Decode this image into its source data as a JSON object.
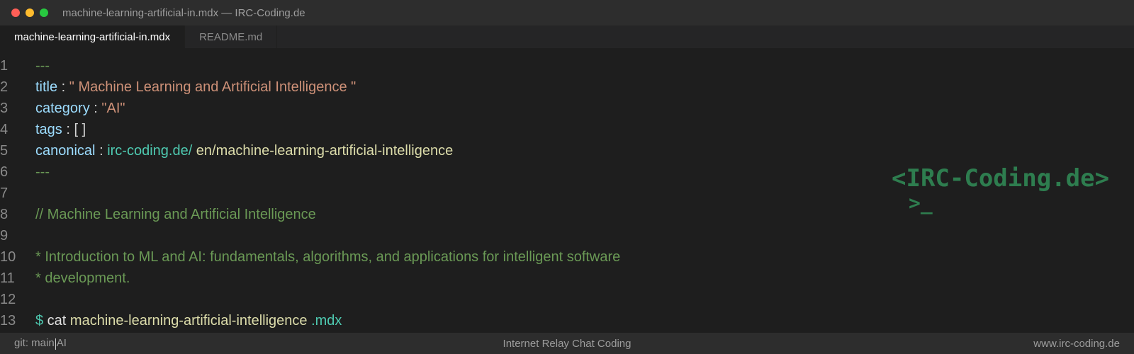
{
  "window": {
    "title": "machine-learning-artificial-in.mdx — IRC-Coding.de"
  },
  "tabs": [
    {
      "label": "machine-learning-artificial-in.mdx",
      "active": true
    },
    {
      "label": "README.md",
      "active": false
    }
  ],
  "editor": {
    "lines": [
      {
        "num": "1",
        "dash": "---"
      },
      {
        "num": "2",
        "key": "title",
        "colon": " : ",
        "value": "\" Machine Learning and Artificial Intelligence \""
      },
      {
        "num": "3",
        "key": "category",
        "colon": " : ",
        "value": "\"AI\""
      },
      {
        "num": "4",
        "key": "tags",
        "colon": " : ",
        "value": "[ ]"
      },
      {
        "num": "5",
        "key": "canonical",
        "colon": " : ",
        "link": "irc-coding.de/",
        "path": " en/machine-learning-artificial-intelligence"
      },
      {
        "num": "6",
        "dash": "---"
      },
      {
        "num": "7"
      },
      {
        "num": "8",
        "comment": "// Machine Learning and Artificial Intelligence"
      },
      {
        "num": "9"
      },
      {
        "num": "10",
        "comment": "* Introduction to ML and AI: fundamentals, algorithms, and applications for intelligent software"
      },
      {
        "num": "11",
        "comment": "* development."
      },
      {
        "num": "12"
      },
      {
        "num": "13",
        "prompt": "$",
        "cmd": " cat ",
        "file": "machine-learning-artificial-intelligence",
        "ext": " .mdx"
      }
    ]
  },
  "logo": {
    "text": "<IRC-Coding.de>",
    "cursor": ">_"
  },
  "statusbar": {
    "branch": "git: main",
    "tag": "AI",
    "center": "Internet Relay Chat Coding",
    "right": "www.irc-coding.de"
  },
  "colors": {
    "background": "#1e1e1e",
    "key": "#9cdcfe",
    "string": "#ce9178",
    "comment": "#6a9955",
    "link": "#4ec9b0",
    "path": "#dcdcaa",
    "logo": "#2e7d4f"
  }
}
